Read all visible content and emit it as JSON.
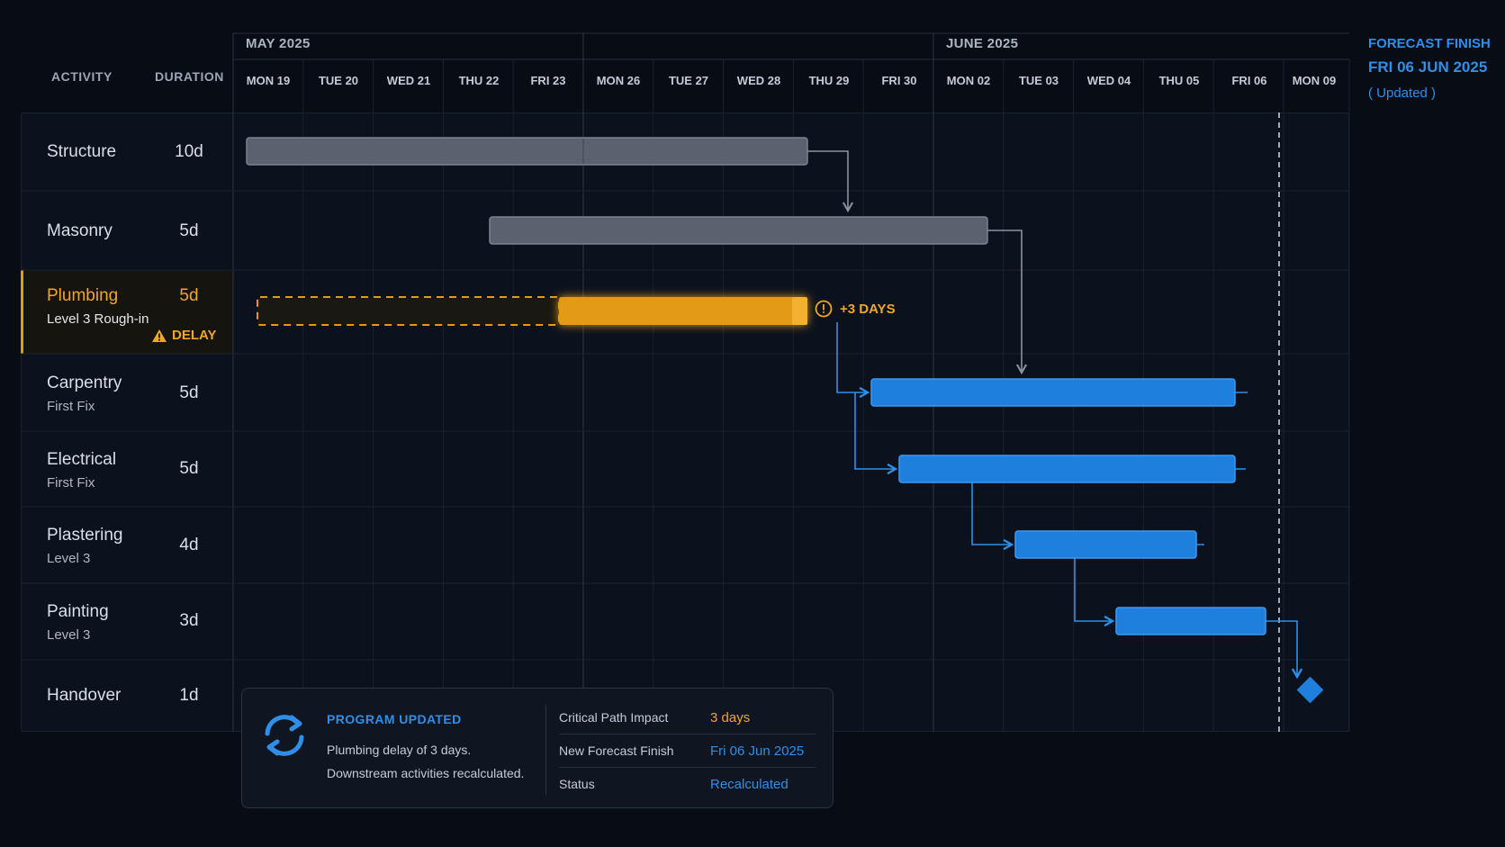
{
  "header": {
    "activity_col": "ACTIVITY",
    "duration_col": "DURATION",
    "months": [
      {
        "label": "MAY 2025",
        "startDay": 0
      },
      {
        "label": "JUNE 2025",
        "startDay": 10
      }
    ],
    "days": [
      "MON 19",
      "TUE 20",
      "WED 21",
      "THU 22",
      "FRI 23",
      "MON 26",
      "TUE 27",
      "WED 28",
      "THU 29",
      "FRI 30",
      "MON 02",
      "TUE 03",
      "WED 04",
      "THU 05",
      "FRI 06",
      "MON 09"
    ]
  },
  "forecast": {
    "label": "FORECAST FINISH",
    "date": "FRI 06 JUN 2025",
    "note": "( Updated )"
  },
  "activities": [
    {
      "name": "Structure",
      "sub": "",
      "duration": "10d"
    },
    {
      "name": "Masonry",
      "sub": "",
      "duration": "5d"
    },
    {
      "name": "Plumbing",
      "sub": "Level 3 Rough-in",
      "duration": "5d",
      "flag": "DELAY"
    },
    {
      "name": "Carpentry",
      "sub": "First Fix",
      "duration": "5d"
    },
    {
      "name": "Electrical",
      "sub": "First Fix",
      "duration": "5d"
    },
    {
      "name": "Plastering",
      "sub": "Level 3",
      "duration": "4d"
    },
    {
      "name": "Painting",
      "sub": "Level 3",
      "duration": "3d"
    },
    {
      "name": "Handover",
      "sub": "",
      "duration": "1d"
    }
  ],
  "delay_badge": "+3 DAYS",
  "colors": {
    "completed": "#5a6270",
    "delayed": "#e39a18",
    "scheduled": "#1f7fdc",
    "accent": "#2f8fe8",
    "warning": "#f0a722"
  },
  "toast": {
    "title": "PROGRAM UPDATED",
    "message_line1": "Plumbing delay of 3 days.",
    "message_line2": "Downstream activities recalculated.",
    "rows": [
      {
        "key": "Critical Path Impact",
        "value": "3 days",
        "tone": "warning"
      },
      {
        "key": "New Forecast Finish",
        "value": "Fri 06 Jun 2025",
        "tone": "accent"
      },
      {
        "key": "Status",
        "value": "Recalculated",
        "tone": "accent"
      }
    ]
  }
}
